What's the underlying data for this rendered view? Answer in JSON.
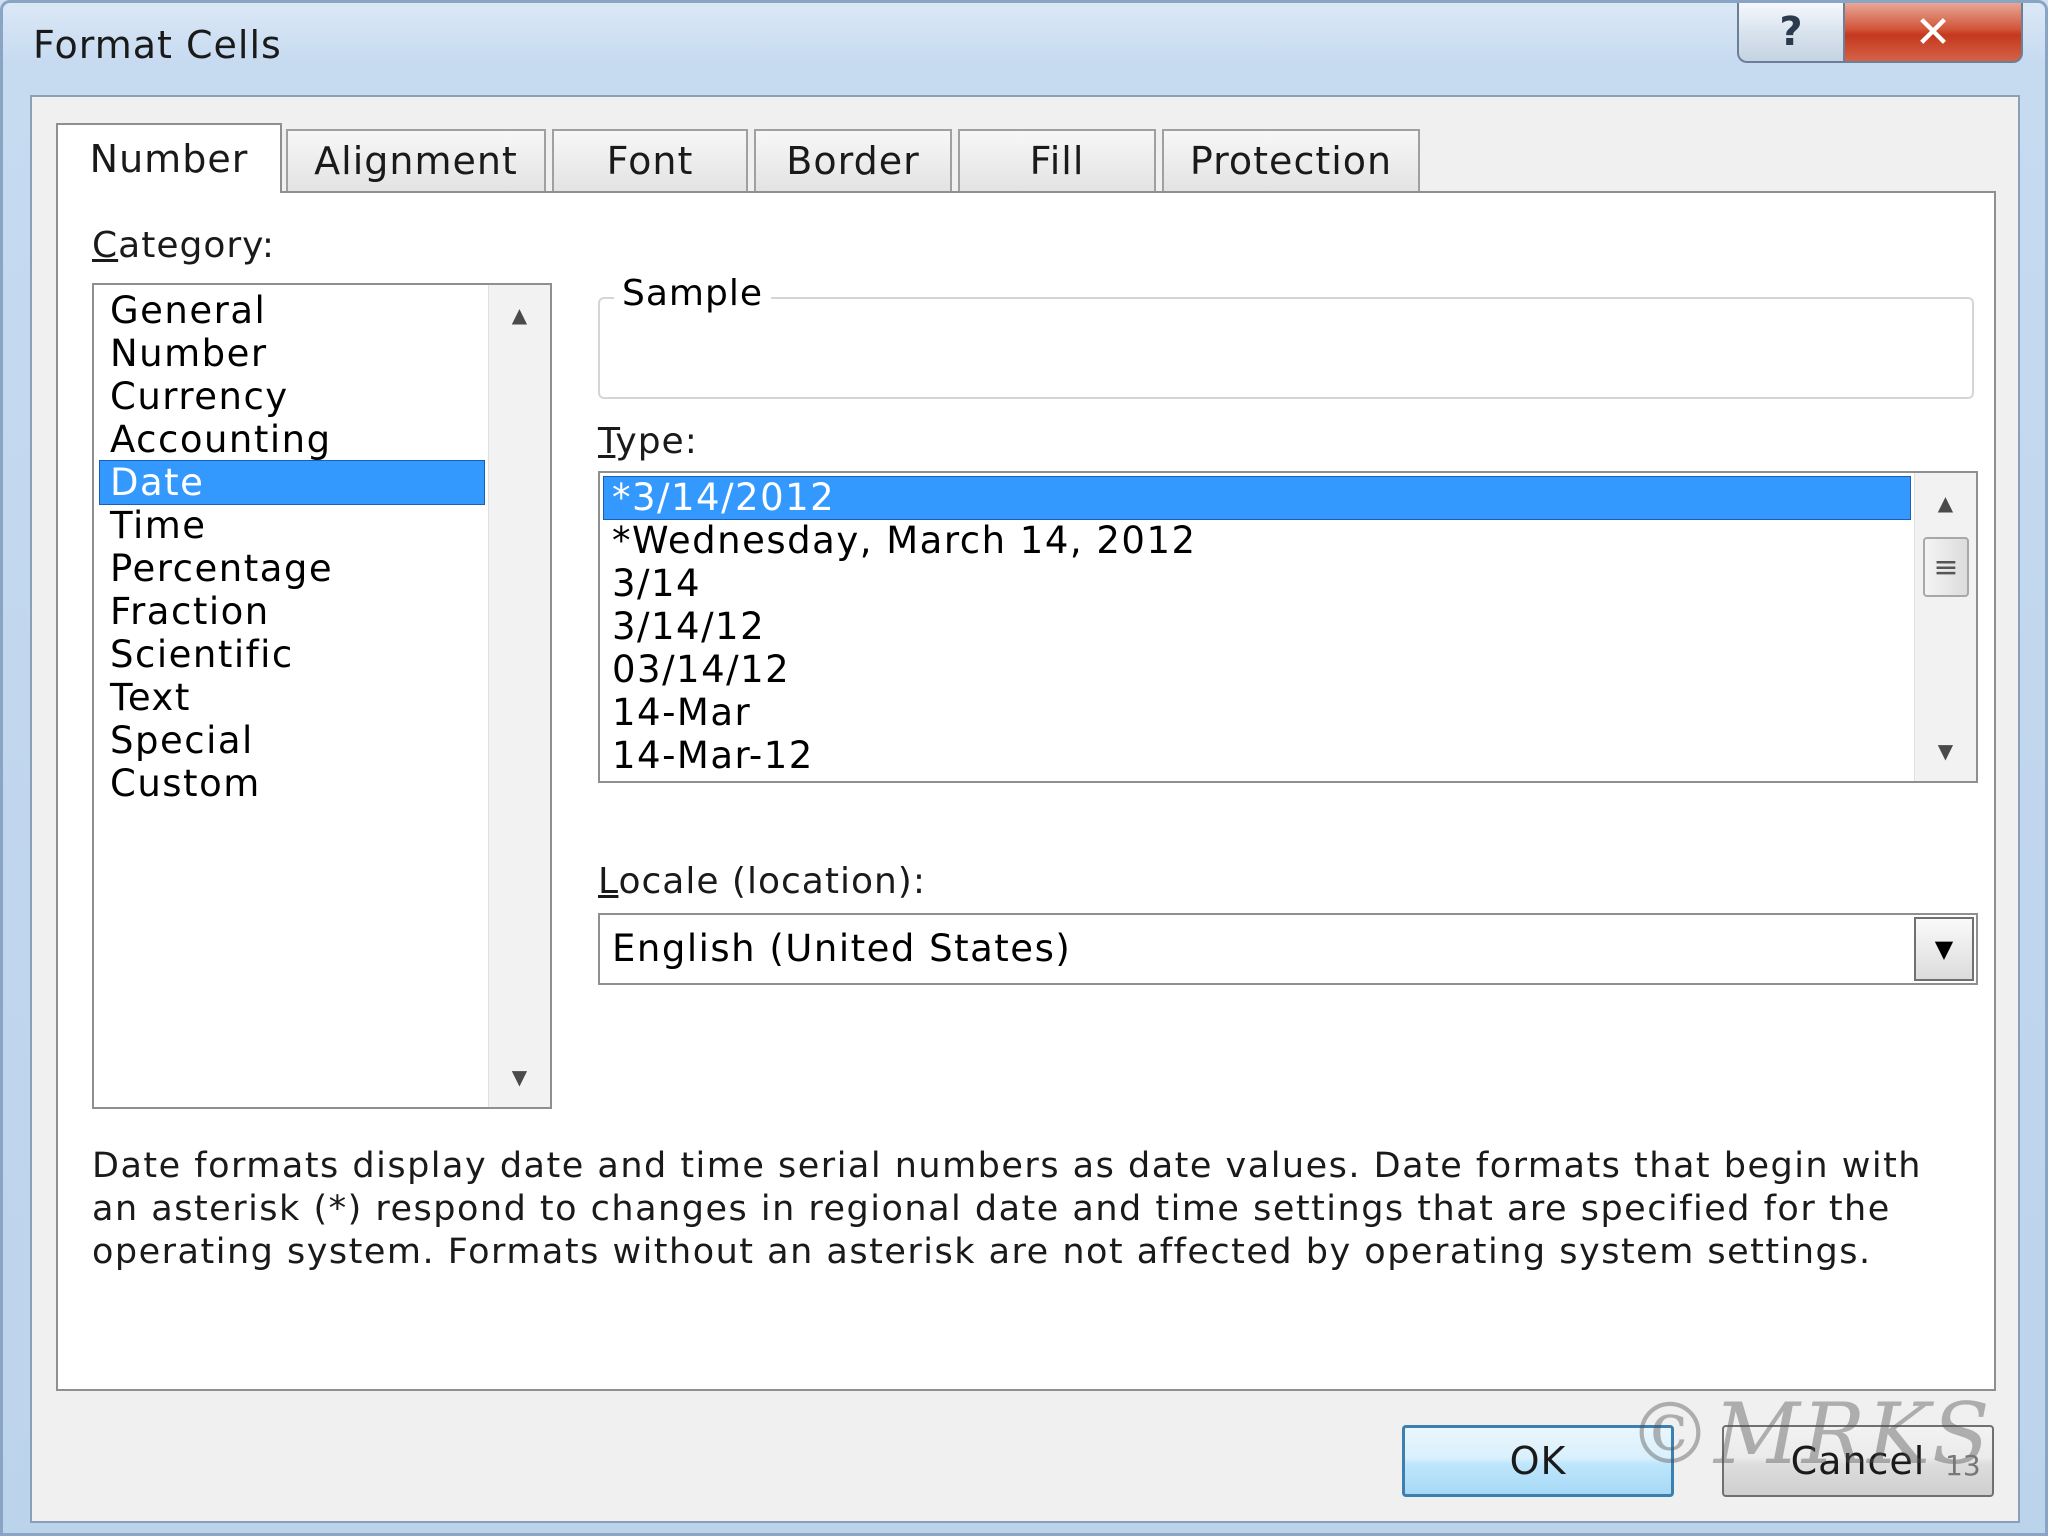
{
  "window": {
    "title": "Format Cells",
    "help_label": "?",
    "close_label": "✕"
  },
  "tabs": [
    {
      "label": "Number",
      "active": true
    },
    {
      "label": "Alignment",
      "active": false
    },
    {
      "label": "Font",
      "active": false
    },
    {
      "label": "Border",
      "active": false
    },
    {
      "label": "Fill",
      "active": false
    },
    {
      "label": "Protection",
      "active": false
    }
  ],
  "category": {
    "label_accel": "C",
    "label_rest": "ategory:",
    "items": [
      "General",
      "Number",
      "Currency",
      "Accounting",
      "Date",
      "Time",
      "Percentage",
      "Fraction",
      "Scientific",
      "Text",
      "Special",
      "Custom"
    ],
    "selected": "Date"
  },
  "sample": {
    "label": "Sample",
    "value": ""
  },
  "type": {
    "label_accel": "T",
    "label_rest": "ype:",
    "items": [
      "*3/14/2012",
      "*Wednesday, March 14, 2012",
      "3/14",
      "3/14/12",
      "03/14/12",
      "14-Mar",
      "14-Mar-12"
    ],
    "selected": "*3/14/2012"
  },
  "locale": {
    "label_accel": "L",
    "label_rest": "ocale (location):",
    "value": "English (United States)"
  },
  "description": "Date formats display date and time serial numbers as date values.  Date formats that begin with an asterisk (*) respond to changes in regional date and time settings that are specified for the operating system. Formats without an asterisk are not affected by operating system settings.",
  "buttons": {
    "ok": "OK",
    "cancel": "Cancel"
  },
  "watermark": "©MRKS",
  "page_number": "13",
  "icons": {
    "scroll_up": "up-arrow-icon",
    "scroll_down": "down-arrow-icon",
    "dropdown": "chevron-down-icon",
    "thumb_grip": "grip-icon"
  },
  "colors": {
    "selection": "#3399ff",
    "window_frame": "#bcd3ec",
    "close_button": "#c4381e",
    "ok_border": "#3c7fb1"
  }
}
